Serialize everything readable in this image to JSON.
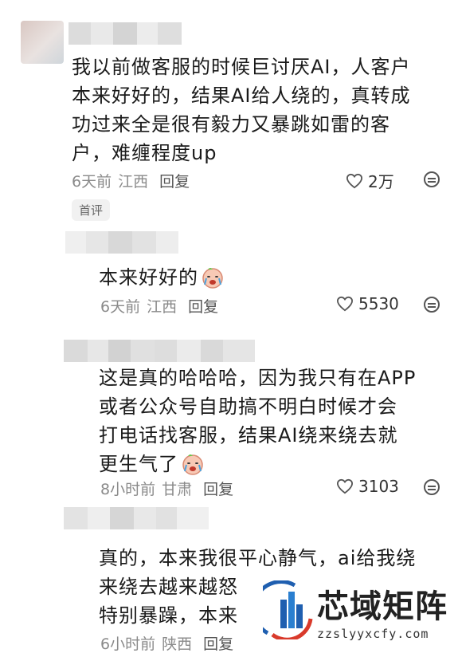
{
  "comments": [
    {
      "text": "我以前做客服的时候巨讨厌AI，人客户\n本来好好的，结果AI给人绕的，真转成\n功过来全是很有毅力又暴跳如雷的客\n户，难缠程度up",
      "time": "6天前",
      "location": "江西",
      "reply": "回复",
      "likes": "2万",
      "badge": "首评"
    },
    {
      "text": "本来好好的",
      "time": "6天前",
      "location": "江西",
      "reply": "回复",
      "likes": "5530"
    },
    {
      "text": "这是真的哈哈哈，因为我只有在APP\n或者公众号自助搞不明白时候才会\n打电话找客服，结果AI绕来绕去就\n更生气了",
      "time": "8小时前",
      "location": "甘肃",
      "reply": "回复",
      "likes": "3103"
    },
    {
      "text": "真的，本来我很平心静气，ai给我绕\n来绕去越来越怒\n特别暴躁，本来",
      "time": "6小时前",
      "location": "陕西",
      "reply": "回复"
    }
  ],
  "watermark": {
    "name": "芯域矩阵",
    "url": "zzslyyxcfy.com"
  }
}
